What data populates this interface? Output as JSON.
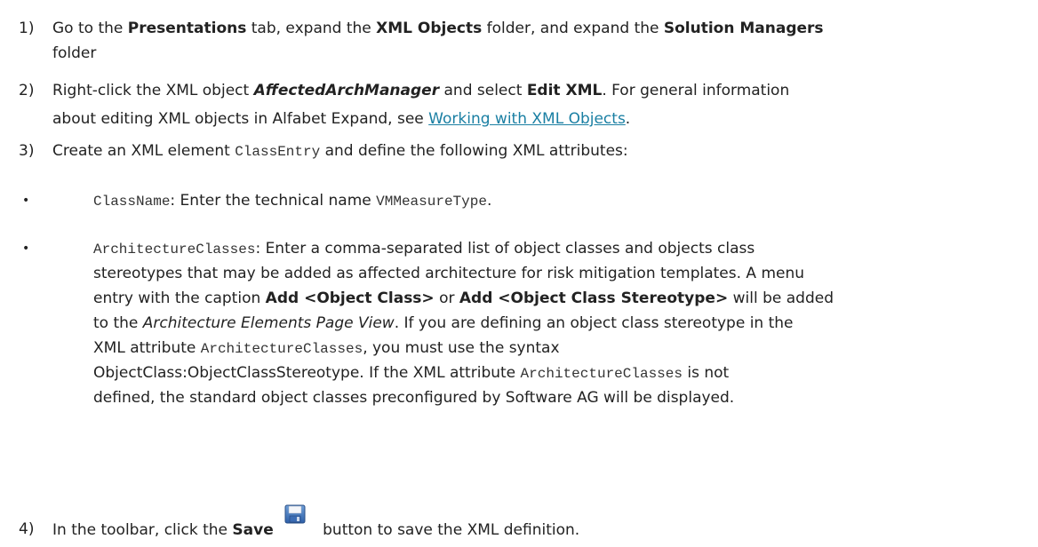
{
  "steps": [
    {
      "num": "1)",
      "line1": {
        "t1": "Go to the ",
        "b1": "Presentations",
        "t2": " tab, expand the ",
        "b2": "XML Objects",
        "t3": " folder, and expand the ",
        "b3": "Solution Managers"
      },
      "line2": "folder"
    },
    {
      "num": "2)",
      "line1": {
        "t1": "Right-click the XML object ",
        "bi1": "AffectedArchManager",
        "t2": " and select ",
        "b1": "Edit XML",
        "t3": ". For general information"
      },
      "line2": {
        "t1": "about editing XML objects in Alfabet Expand, see ",
        "link": "Working with XML Objects",
        "t2": "."
      }
    },
    {
      "num": "3)",
      "t1": "Create an XML element ",
      "code": "ClassEntry",
      "t2": " and define the following XML attributes:"
    },
    {
      "num": "4)",
      "t1": "In the toolbar, click the ",
      "b1": "Save",
      "t2": " button to save the XML definition."
    }
  ],
  "bullets": [
    {
      "glyph": "•",
      "code1": "ClassName",
      "t1": ": Enter the technical name ",
      "code2": "VMMeasureType",
      "t2": "."
    },
    {
      "glyph": "•",
      "l1": {
        "code1": "ArchitectureClasses",
        "t1": ": Enter a comma-separated list of object classes and objects class"
      },
      "l2": "stereotypes that may be added as affected architecture for risk mitigation templates. A menu",
      "l3": {
        "t1": "entry with the caption ",
        "b1": "Add <Object Class>",
        "t2": " or ",
        "b2": "Add <Object Class Stereotype>",
        "t3": " will be added"
      },
      "l4": {
        "t1": "to the ",
        "i1": "Architecture Elements Page View",
        "t2": ". If you are defining an object class stereotype in the"
      },
      "l5": {
        "t1": "XML attribute ",
        "code1": "ArchitectureClasses",
        "t2": ", you must use the syntax"
      },
      "l6": {
        "t1": "ObjectClass:ObjectClassStereotype. If the XML attribute ",
        "code1": "ArchitectureClasses",
        "t2": " is not"
      },
      "l7": "defined, the standard object classes preconfigured by Software AG will be displayed."
    }
  ],
  "icons": {
    "save": "save-floppy-icon"
  },
  "colors": {
    "link": "#1a7fa3",
    "text": "#222222"
  }
}
